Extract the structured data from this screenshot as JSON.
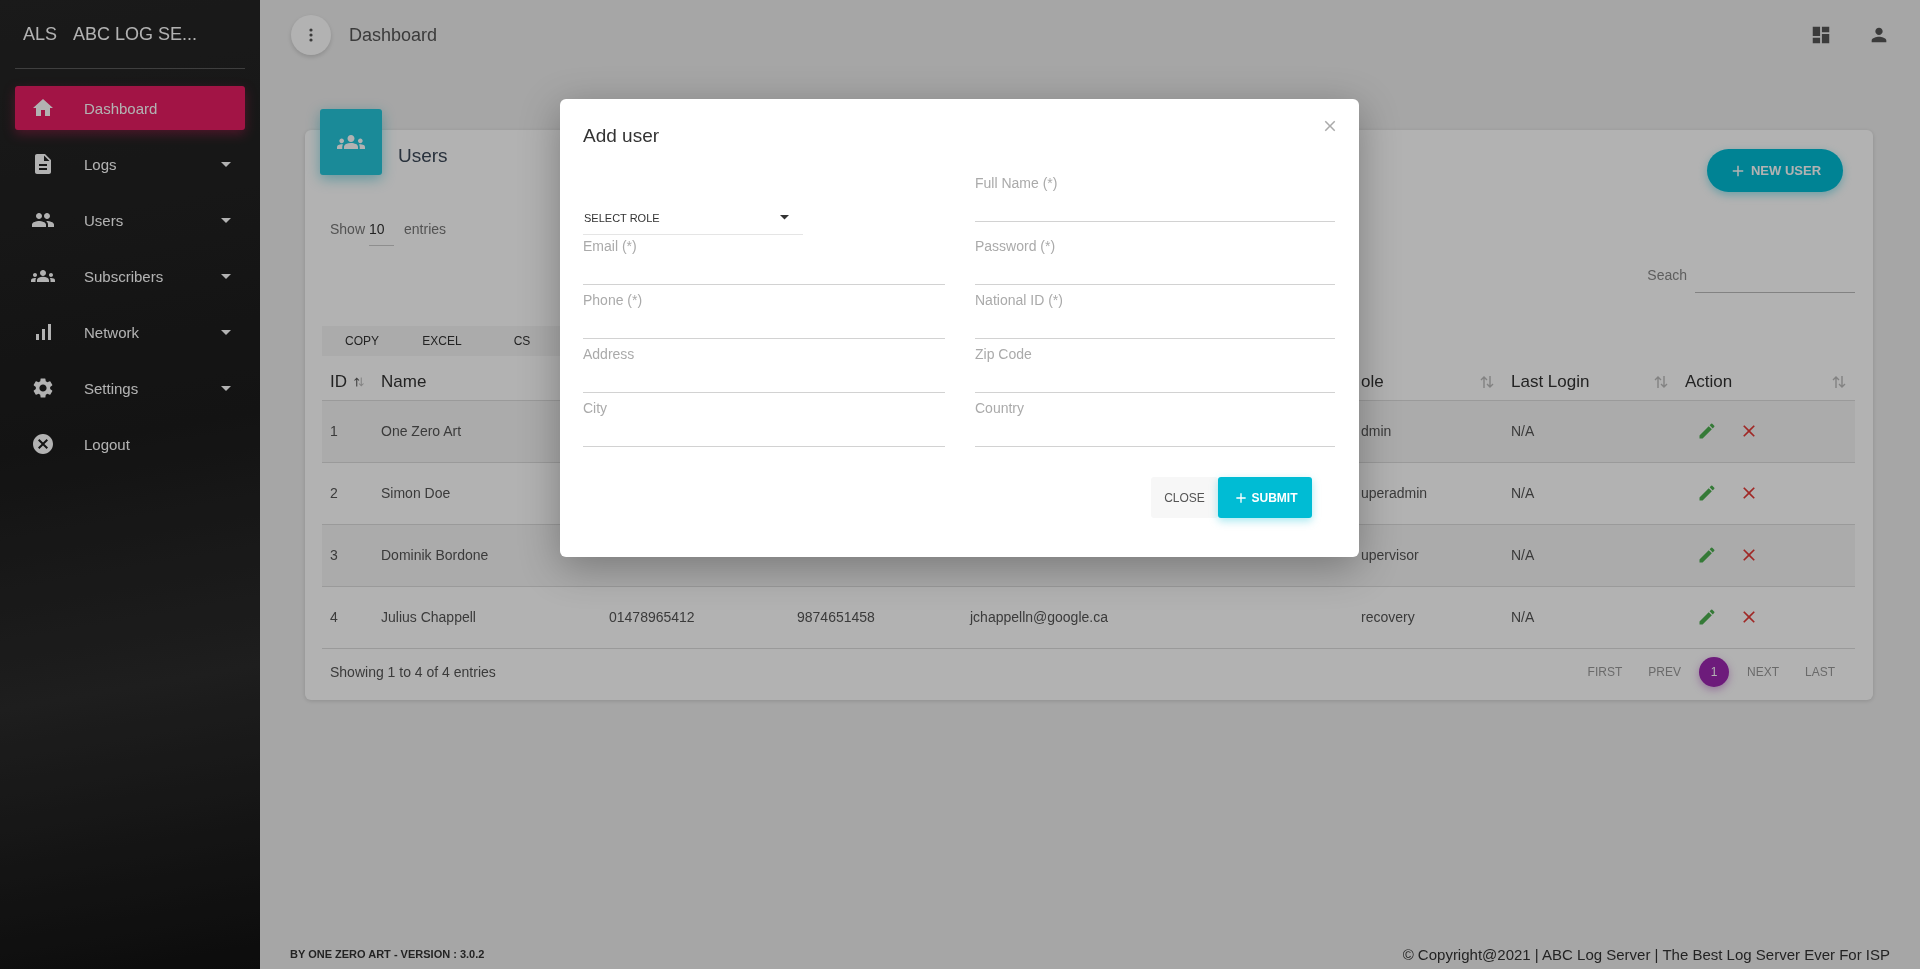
{
  "sidebar": {
    "logo_short": "ALS",
    "logo_text": "ABC LOG SE...",
    "items": [
      {
        "label": "Dashboard",
        "selected": true,
        "has_submenu": false
      },
      {
        "label": "Logs",
        "selected": false,
        "has_submenu": true
      },
      {
        "label": "Users",
        "selected": false,
        "has_submenu": true
      },
      {
        "label": "Subscribers",
        "selected": false,
        "has_submenu": true
      },
      {
        "label": "Network",
        "selected": false,
        "has_submenu": true
      },
      {
        "label": "Settings",
        "selected": false,
        "has_submenu": true
      },
      {
        "label": "Logout",
        "selected": false,
        "has_submenu": false
      }
    ]
  },
  "topbar": {
    "title": "Dashboard"
  },
  "card": {
    "title": "Users",
    "new_button": "NEW USER",
    "show_label": "Show",
    "show_value": "10",
    "entries_label": "entries",
    "search_label": "Seach",
    "export_buttons": [
      "COPY",
      "EXCEL",
      "CS"
    ],
    "columns": [
      {
        "label": "ID",
        "sorted_asc": true
      },
      {
        "label": "Name"
      },
      {
        "label": "ole",
        "sorted_asc": false
      },
      {
        "label": "Last Login",
        "sorted_asc": false
      },
      {
        "label": "Action",
        "sorted_asc": false
      }
    ],
    "rows": [
      {
        "id": "1",
        "name": "One Zero Art",
        "role": "dmin",
        "last_login": "N/A"
      },
      {
        "id": "2",
        "name": "Simon Doe",
        "role": "uperadmin",
        "last_login": "N/A"
      },
      {
        "id": "3",
        "name": "Dominik Bordone",
        "role": "upervisor",
        "last_login": "N/A"
      },
      {
        "id": "4",
        "name": "Julius Chappell",
        "column_3": "01478965412",
        "column_4": "9874651458",
        "column_5": "jchappelln@google.ca",
        "role": "recovery",
        "last_login": "N/A"
      }
    ],
    "info": "Showing 1 to 4 of 4 entries",
    "pagination": [
      {
        "label": "FIRST",
        "selected": false
      },
      {
        "label": "PREV",
        "selected": false
      },
      {
        "label": "1",
        "selected": true
      },
      {
        "label": "NEXT",
        "selected": false
      },
      {
        "label": "LAST",
        "selected": false
      }
    ]
  },
  "footer": {
    "left": "BY ONE ZERO ART - VERSION : 3.0.2",
    "right": "© Copyright@2021 | ABC Log Server | The Best Log Server Ever For ISP"
  },
  "modal": {
    "title": "Add user",
    "role_select": "SELECT ROLE",
    "left_fields": [
      {
        "placeholder": "Email (*)"
      },
      {
        "placeholder": "Phone (*)"
      },
      {
        "placeholder": "Address"
      },
      {
        "placeholder": "City"
      }
    ],
    "right_fields": [
      {
        "placeholder": "Full Name (*)"
      },
      {
        "placeholder": "Password (*)"
      },
      {
        "placeholder": "National ID (*)"
      },
      {
        "placeholder": "Zip Code"
      },
      {
        "placeholder": "Country"
      }
    ],
    "close_button": "CLOSE",
    "submit_button": "SUBMIT"
  }
}
